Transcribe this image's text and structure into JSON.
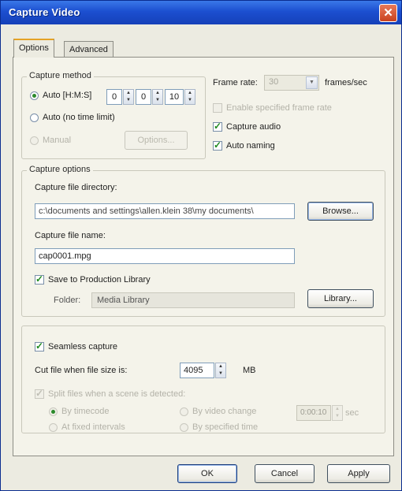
{
  "window": {
    "title": "Capture Video",
    "close_symbol": "✕"
  },
  "tabs": [
    {
      "label": "Options"
    },
    {
      "label": "Advanced"
    }
  ],
  "capture_method": {
    "legend": "Capture method",
    "auto_hms_label": "Auto [H:M:S]",
    "hours": "0",
    "minutes": "0",
    "seconds": "10",
    "auto_no_limit_label": "Auto (no time limit)",
    "manual_label": "Manual",
    "options_button": "Options..."
  },
  "frame_rate": {
    "label": "Frame rate:",
    "value": "30",
    "units": "frames/sec",
    "limit_label": "Enable specified frame rate",
    "capture_audio_label": "Capture audio",
    "auto_naming_label": "Auto naming"
  },
  "capture_options": {
    "legend": "Capture options",
    "directory_label": "Capture file directory:",
    "directory_value": "c:\\documents and settings\\allen.klein 38\\my documents\\",
    "browse_button": "Browse...",
    "filename_label": "Capture file name:",
    "filename_value": "cap0001.mpg",
    "save_library_label": "Save to Production Library",
    "folder_label": "Folder:",
    "folder_value": "Media Library",
    "library_button": "Library..."
  },
  "seamless": {
    "label": "Seamless capture",
    "cut_label": "Cut file when file size is:",
    "size_value": "4095",
    "size_units": "MB",
    "split_label": "Split files when a scene is detected:",
    "opt1": "By timecode",
    "opt2": "At fixed intervals",
    "opt3": "By video change",
    "opt4": "By specified time",
    "interval_value": "0:00:10",
    "interval_units": "sec"
  },
  "footer": {
    "ok": "OK",
    "cancel": "Cancel",
    "apply": "Apply"
  },
  "state": {
    "auto_hms": true,
    "capture_audio": true,
    "auto_naming": true,
    "save_to_library": true,
    "seamless_capture": true
  }
}
